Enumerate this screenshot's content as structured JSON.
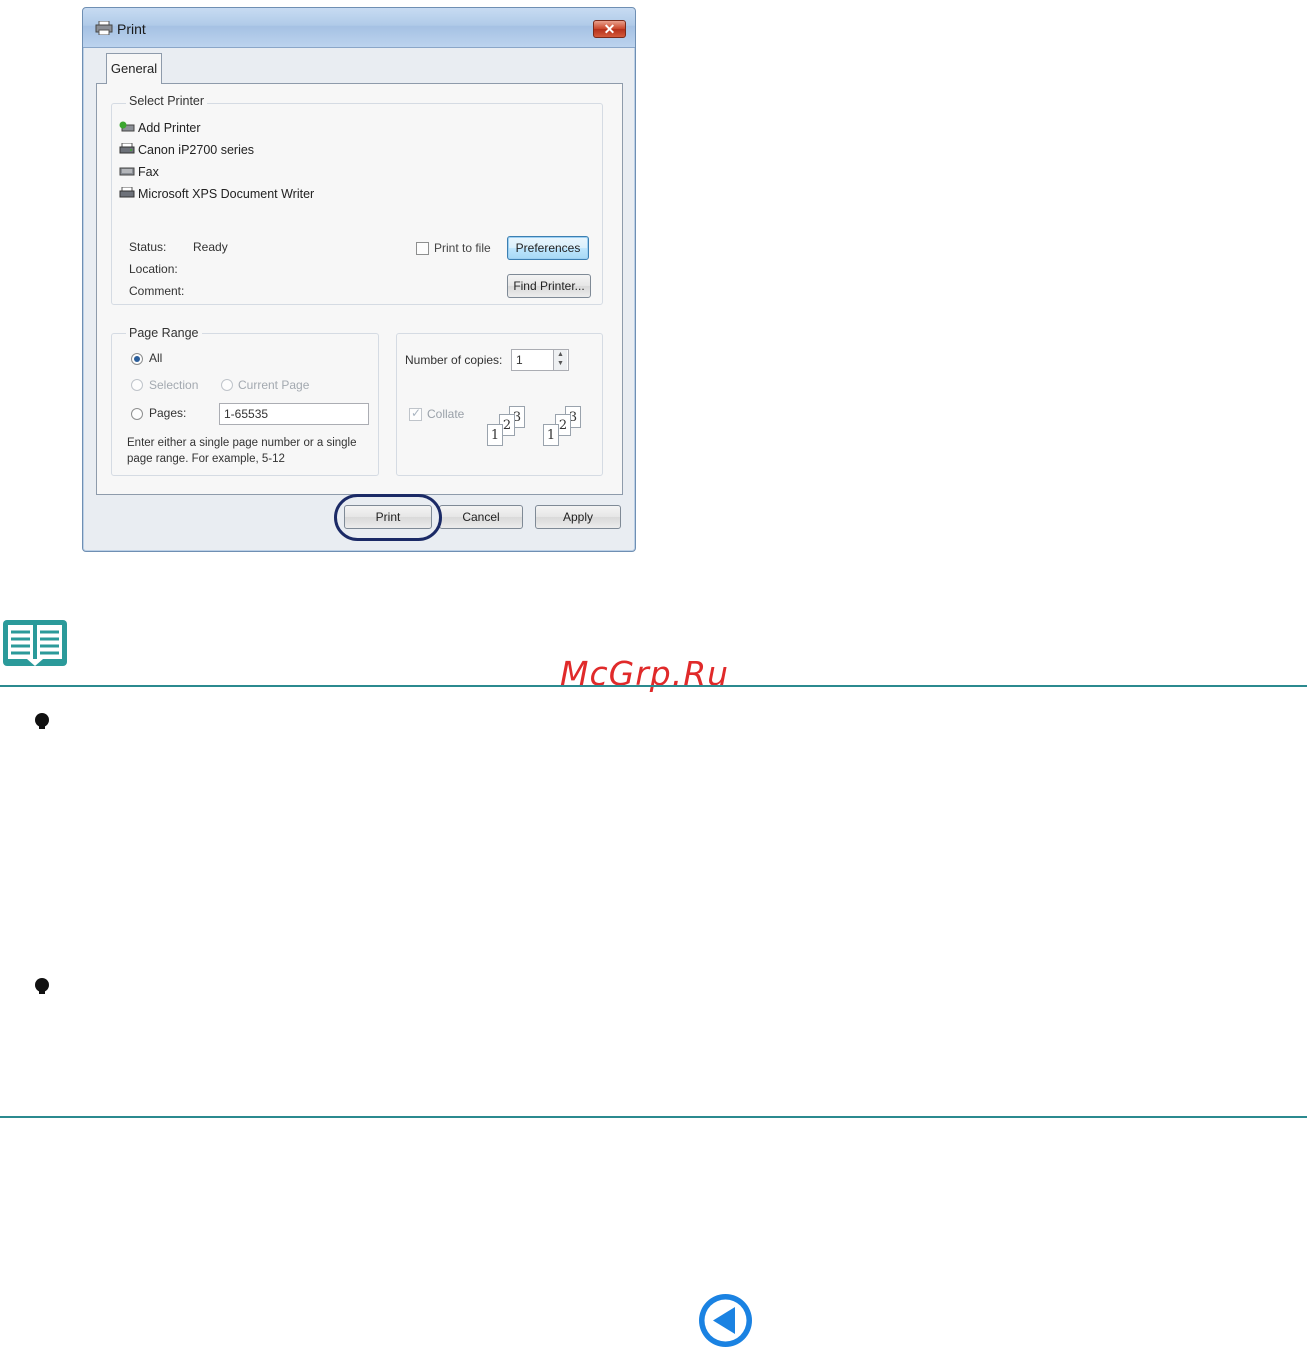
{
  "dialog": {
    "title": "Print",
    "close_glyph": "✕",
    "tabs": [
      {
        "label": "General"
      }
    ],
    "select_printer": {
      "group_label": "Select Printer",
      "printers": [
        {
          "name": "Add Printer",
          "icon": "add-printer-icon"
        },
        {
          "name": "Canon iP2700 series",
          "icon": "printer-icon",
          "selected": true
        },
        {
          "name": "Fax",
          "icon": "fax-icon"
        },
        {
          "name": "Microsoft XPS Document Writer",
          "icon": "printer-icon"
        }
      ],
      "status_label": "Status:",
      "status_value": "Ready",
      "location_label": "Location:",
      "comment_label": "Comment:",
      "print_to_file_label": "Print to file",
      "preferences_button": "Preferences",
      "find_printer_button": "Find Printer..."
    },
    "page_range": {
      "group_label": "Page Range",
      "all_label": "All",
      "selection_label": "Selection",
      "current_page_label": "Current Page",
      "pages_label": "Pages:",
      "pages_value": "1-65535",
      "hint": "Enter either a single page number or a single page range.  For example, 5-12"
    },
    "copies": {
      "number_label": "Number of copies:",
      "number_value": "1",
      "collate_label": "Collate",
      "collate_checked": true
    },
    "buttons": {
      "print": "Print",
      "cancel": "Cancel",
      "apply": "Apply"
    },
    "highlight_color": "#1b2a66"
  },
  "note": {
    "icon": "book-note-icon",
    "rule_color": "#2b8a8f"
  },
  "watermark": {
    "text": "McGrp.Ru",
    "color": "#e02a2a"
  },
  "navigation": {
    "back_icon": "back-arrow-icon",
    "color": "#1a82e2"
  }
}
